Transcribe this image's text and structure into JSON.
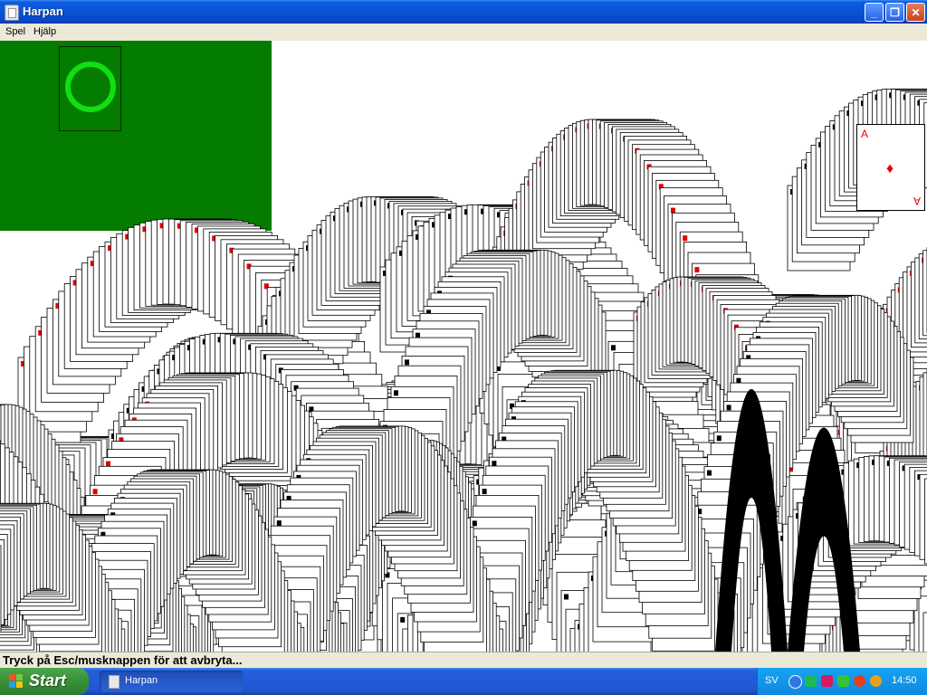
{
  "window": {
    "title": "Harpan"
  },
  "menu": {
    "items": [
      "Spel",
      "Hjälp"
    ]
  },
  "status": {
    "text": "Tryck på Esc/musknappen för att avbryta..."
  },
  "cards": {
    "ace_rank": "A",
    "ace_suit": "♦"
  },
  "taskbar": {
    "start_label": "Start",
    "task_label": "Harpan",
    "language": "SV",
    "clock": "14:50"
  },
  "colors": {
    "felt_green": "#047c00",
    "slot_ring": "#10e010",
    "red_suit": "#e00000",
    "xp_blue": "#0a55d8"
  },
  "icons": {
    "minimize": "minimize-icon",
    "maximize": "maximize-icon",
    "close": "close-icon"
  }
}
